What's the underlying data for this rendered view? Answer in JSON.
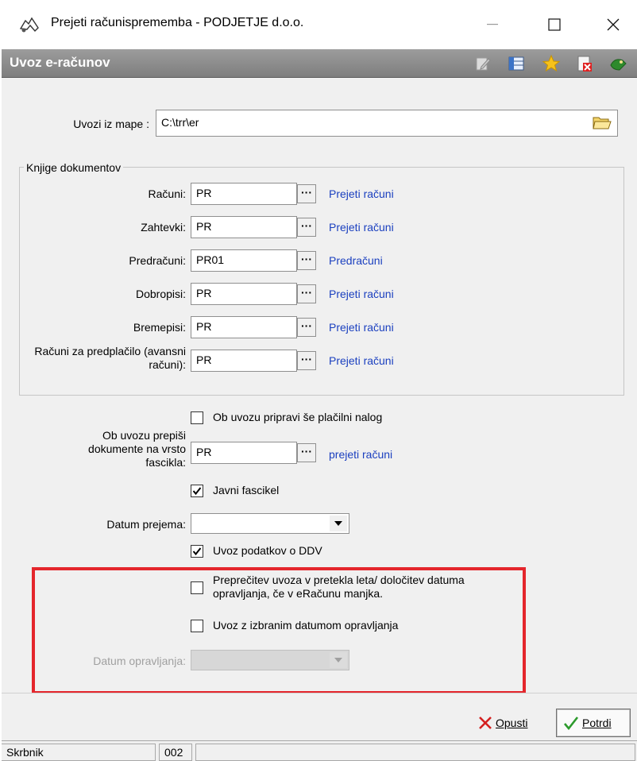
{
  "window": {
    "title": "Prejeti računisprememba - PODJETJE d.o.o.",
    "minimize_glyph": "—",
    "maximize_glyph": "☐",
    "close_glyph": "✕"
  },
  "header": {
    "title": "Uvoz e-računov",
    "icons": [
      "edit-icon",
      "columns-icon",
      "star-icon",
      "close-doc-icon",
      "exit-icon"
    ]
  },
  "folder": {
    "label": "Uvozi iz mape :",
    "value": "C:\\trr\\er"
  },
  "books": {
    "legend": "Knjige dokumentov",
    "rows": [
      {
        "label": "Računi:",
        "value": "PR",
        "link": "Prejeti računi"
      },
      {
        "label": "Zahtevki:",
        "value": "PR",
        "link": "Prejeti računi"
      },
      {
        "label": "Predračuni:",
        "value": "PR01",
        "link": "Predračuni"
      },
      {
        "label": "Dobropisi:",
        "value": "PR",
        "link": "Prejeti računi"
      },
      {
        "label": "Bremepisi:",
        "value": "PR",
        "link": "Prejeti računi"
      },
      {
        "label": "Računi za predplačilo (avansni računi):",
        "value": "PR",
        "link": "Prejeti računi"
      }
    ]
  },
  "options": {
    "payment_order": "Ob uvozu pripravi še plačilni nalog",
    "folder_type_label": "Ob uvozu prepiši dokumente na vrsto fascikla:",
    "folder_type_value": "PR",
    "folder_type_link": "prejeti računi",
    "public_folder": "Javni fascikel",
    "receipt_date_label": "Datum prejema:",
    "receipt_date_value": "",
    "vat_import": "Uvoz podatkov o DDV",
    "prevent_past": "Preprečitev uvoza v pretekla leta/ določitev datuma opravljanja, če v eRačunu manjka.",
    "selected_date": "Uvoz z izbranim datumom opravljanja",
    "service_date_label": "Datum opravljanja:",
    "service_date_value": ""
  },
  "buttons": {
    "cancel": "Opusti",
    "confirm": "Potrdi"
  },
  "status": {
    "user": "Skrbnik",
    "code": "002",
    "extra": ""
  },
  "colors": {
    "link": "#1a3fbf",
    "highlight": "#e4262c",
    "header": "#8e8e8e"
  }
}
